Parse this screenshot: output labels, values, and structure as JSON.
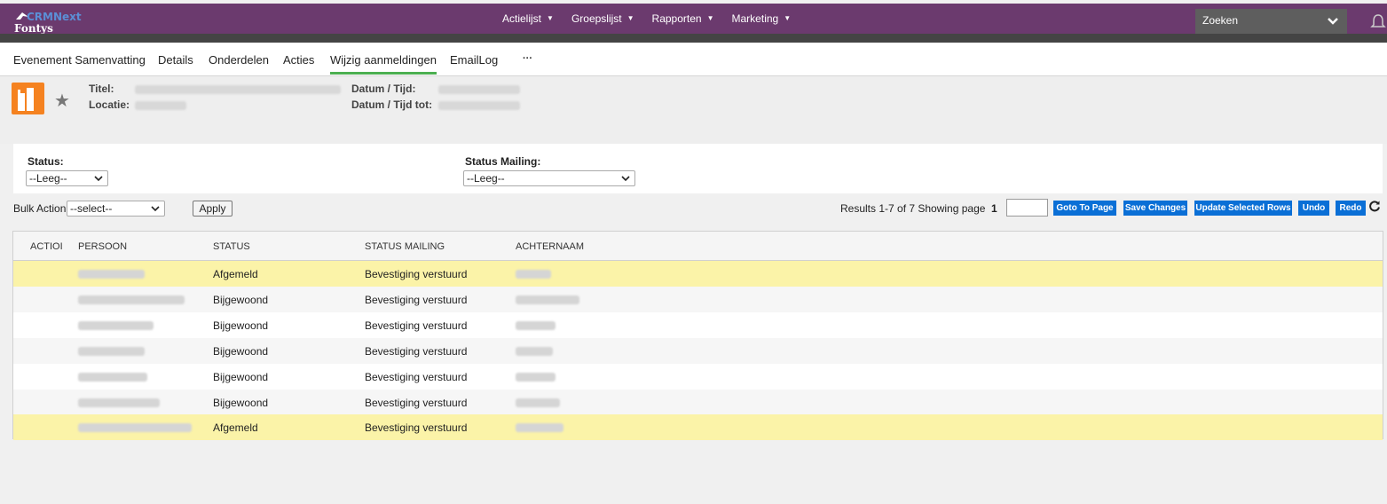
{
  "app": {
    "logo_text": "CRMNext",
    "logo_sub": "Fontys"
  },
  "nav": {
    "items": [
      "Actielijst",
      "Groepslijst",
      "Rapporten",
      "Marketing"
    ],
    "search_placeholder": "Zoeken"
  },
  "tabs": [
    "Evenement Samenvatting",
    "Details",
    "Onderdelen",
    "Acties",
    "Wijzig aanmeldingen",
    "EmailLog",
    "···"
  ],
  "active_tab": "Wijzig aanmeldingen",
  "event": {
    "titel_label": "Titel:",
    "locatie_label": "Locatie:",
    "datum_label": "Datum / Tijd:",
    "datum_tot_label": "Datum / Tijd tot:"
  },
  "filters": {
    "status_label": "Status:",
    "status_value": "--Leeg--",
    "mailing_label": "Status Mailing:",
    "mailing_value": "--Leeg--"
  },
  "bulk": {
    "label": "Bulk Action",
    "value": "--select--",
    "apply": "Apply",
    "results": "Results 1-7 of 7 Showing page",
    "page": "1",
    "buttons": [
      "Goto To Page",
      "Save Changes",
      "Update Selected Rows",
      "Undo",
      "Redo"
    ]
  },
  "table": {
    "headers": [
      "ACTIOI",
      "PERSOON",
      "STATUS",
      "STATUS MAILING",
      "ACHTERNAAM"
    ],
    "rows": [
      {
        "status": "Afgemeld",
        "mailing": "Bevestiging verstuurd",
        "highlight": true
      },
      {
        "status": "Bijgewoond",
        "mailing": "Bevestiging verstuurd",
        "highlight": false
      },
      {
        "status": "Bijgewoond",
        "mailing": "Bevestiging verstuurd",
        "highlight": false
      },
      {
        "status": "Bijgewoond",
        "mailing": "Bevestiging verstuurd",
        "highlight": false
      },
      {
        "status": "Bijgewoond",
        "mailing": "Bevestiging verstuurd",
        "highlight": false
      },
      {
        "status": "Bijgewoond",
        "mailing": "Bevestiging verstuurd",
        "highlight": false
      },
      {
        "status": "Afgemeld",
        "mailing": "Bevestiging verstuurd",
        "highlight": true
      }
    ]
  },
  "colors": {
    "topbar": "#6b3a6e",
    "accent": "#4caf50",
    "button": "#0a6fd6",
    "highlight": "#fbf3a8"
  }
}
